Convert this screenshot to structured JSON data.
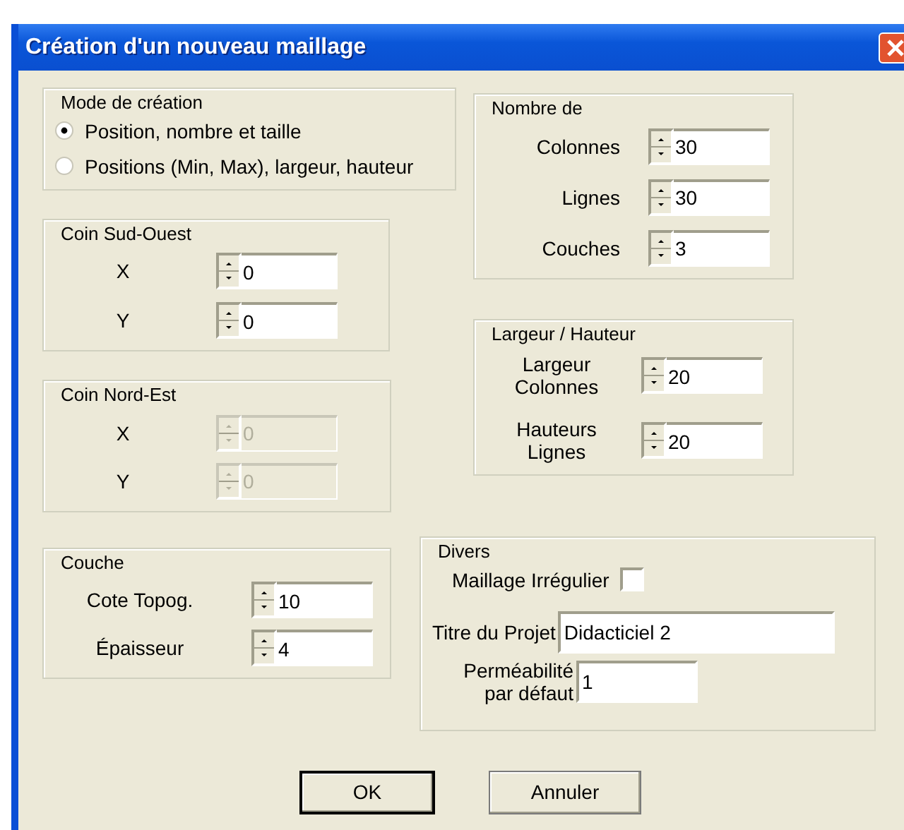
{
  "window": {
    "title": "Création d'un nouveau maillage"
  },
  "mode_de_creation": {
    "title": "Mode de création",
    "options": [
      {
        "label": "Position, nombre et taille",
        "selected": true
      },
      {
        "label": "Positions (Min, Max), largeur, hauteur",
        "selected": false
      }
    ]
  },
  "coin_sud_ouest": {
    "title": "Coin Sud-Ouest",
    "fields": [
      {
        "label": "X",
        "value": "0",
        "disabled": false
      },
      {
        "label": "Y",
        "value": "0",
        "disabled": false
      }
    ]
  },
  "coin_nord_est": {
    "title": "Coin Nord-Est",
    "fields": [
      {
        "label": "X",
        "value": "0",
        "disabled": true
      },
      {
        "label": "Y",
        "value": "0",
        "disabled": true
      }
    ]
  },
  "nombre_de": {
    "title": "Nombre de",
    "fields": [
      {
        "label": "Colonnes",
        "value": "30",
        "disabled": false
      },
      {
        "label": "Lignes",
        "value": "30",
        "disabled": false
      },
      {
        "label": "Couches",
        "value": "3",
        "disabled": false
      }
    ]
  },
  "largeur_hauteur": {
    "title": "Largeur / Hauteur",
    "fields": [
      {
        "label": "Largeur Colonnes",
        "value": "20",
        "disabled": false
      },
      {
        "label": "Hauteurs Lignes",
        "value": "20",
        "disabled": false
      }
    ]
  },
  "couche": {
    "title": "Couche",
    "fields": [
      {
        "label": "Cote Topog.",
        "value": "10",
        "disabled": false
      },
      {
        "label": "Épaisseur",
        "value": "4",
        "disabled": false
      }
    ]
  },
  "divers": {
    "title": "Divers",
    "checkbox": {
      "label": "Maillage Irrégulier",
      "checked": false
    },
    "fields": [
      {
        "label": "Titre du Projet",
        "value": "Didacticiel 2"
      },
      {
        "label": "Perméabilité par défaut",
        "value": "1"
      }
    ]
  },
  "buttons": [
    {
      "label": "OK",
      "default": true
    },
    {
      "label": "Annuler",
      "default": false
    }
  ]
}
